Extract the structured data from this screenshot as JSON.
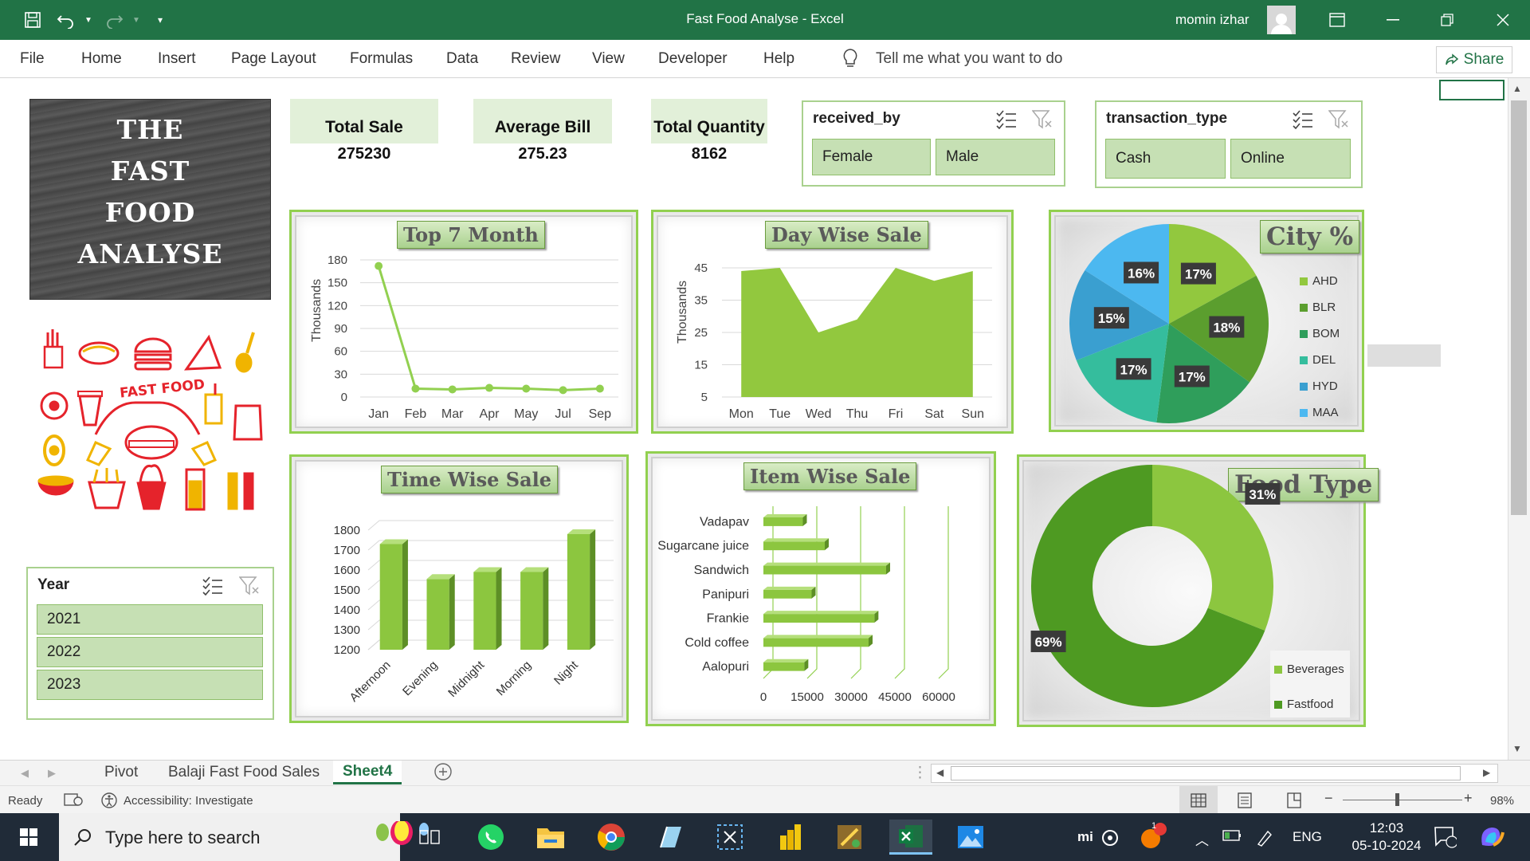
{
  "window": {
    "title": "Fast Food Analyse  -  Excel",
    "user": "momin izhar"
  },
  "ribbon": {
    "tabs": [
      "File",
      "Home",
      "Insert",
      "Page Layout",
      "Formulas",
      "Data",
      "Review",
      "View",
      "Developer",
      "Help"
    ],
    "tell_me": "Tell me what you want to do",
    "share": "Share"
  },
  "dashboard": {
    "logo_lines": [
      "THE",
      "FAST",
      "FOOD",
      "ANALYSE"
    ],
    "kpis": [
      {
        "label": "Total Sale",
        "value": "275230"
      },
      {
        "label": "Average Bill",
        "value": "275.23"
      },
      {
        "label": "Total Quantity",
        "value": "8162"
      }
    ],
    "slicers": {
      "received_by": {
        "header": "received_by",
        "items": [
          "Female",
          "Male"
        ]
      },
      "transaction_type": {
        "header": "transaction_type",
        "items": [
          "Cash",
          "Online"
        ]
      },
      "year": {
        "header": "Year",
        "items": [
          "2021",
          "2022",
          "2023"
        ]
      }
    },
    "clipart_label": "FAST FOOD"
  },
  "chart_data": [
    {
      "type": "line",
      "title": "Top 7 Month",
      "ylabel": "Thousands",
      "categories": [
        "Jan",
        "Feb",
        "Mar",
        "Apr",
        "May",
        "Jul",
        "Sep"
      ],
      "values": [
        172,
        11,
        10,
        12,
        11,
        9,
        11
      ],
      "ylim": [
        0,
        180
      ],
      "yticks": [
        0,
        30,
        60,
        90,
        120,
        150,
        180
      ],
      "grid": true,
      "color": "#92d050"
    },
    {
      "type": "area",
      "title": "Day Wise Sale",
      "ylabel": "Thousands",
      "categories": [
        "Mon",
        "Tue",
        "Wed",
        "Thu",
        "Fri",
        "Sat",
        "Sun"
      ],
      "values": [
        44,
        45,
        25,
        29,
        45,
        41,
        44
      ],
      "ylim": [
        5,
        45
      ],
      "yticks": [
        5,
        15,
        25,
        35,
        45
      ],
      "grid": true,
      "color": "#92c83e"
    },
    {
      "type": "pie",
      "title": "City %",
      "categories": [
        "AHD",
        "BLR",
        "BOM",
        "DEL",
        "HYD",
        "MAA"
      ],
      "values": [
        17,
        18,
        17,
        17,
        15,
        16
      ],
      "labels": [
        "17%",
        "18%",
        "17%",
        "17%",
        "15%",
        "16%"
      ],
      "colors": [
        "#92c83e",
        "#5b9e2e",
        "#2f9e5b",
        "#35bd9d",
        "#3a9fd0",
        "#4cb8f0"
      ],
      "legend": "right"
    },
    {
      "type": "bar",
      "title": "Time Wise Sale",
      "categories": [
        "Afternoon",
        "Evening",
        "Midnight",
        "Morning",
        "Night"
      ],
      "values": [
        1730,
        1555,
        1590,
        1590,
        1780
      ],
      "ylim": [
        1200,
        1800
      ],
      "yticks": [
        1200,
        1300,
        1400,
        1500,
        1600,
        1700,
        1800
      ],
      "color": "#92c83e"
    },
    {
      "type": "bar",
      "orientation": "horizontal",
      "title": "Item Wise Sale",
      "categories": [
        "Vadapav",
        "Sugarcane juice",
        "Sandwich",
        "Panipuri",
        "Frankie",
        "Cold coffee",
        "Aalopuri"
      ],
      "values": [
        13500,
        21000,
        42000,
        16500,
        38000,
        36000,
        14000
      ],
      "xlim": [
        0,
        60000
      ],
      "xticks": [
        0,
        15000,
        30000,
        45000,
        60000
      ],
      "color": "#92c83e"
    },
    {
      "type": "pie",
      "subtype": "donut",
      "title": "Food Type",
      "categories": [
        "Beverages",
        "Fastfood"
      ],
      "values": [
        31,
        69
      ],
      "labels": [
        "31%",
        "69%"
      ],
      "colors": [
        "#8cc63f",
        "#4e9a22"
      ],
      "legend": "bottom-right"
    }
  ],
  "sheet_tabs": [
    "Pivot",
    "Balaji Fast Food Sales",
    "Sheet4"
  ],
  "active_sheet": "Sheet4",
  "status": {
    "ready": "Ready",
    "accessibility": "Accessibility: Investigate",
    "zoom": "98%"
  },
  "taskbar": {
    "search_placeholder": "Type here to search",
    "language": "ENG",
    "time": "12:03",
    "date": "05-10-2024",
    "notification_count": "1"
  },
  "colors": {
    "excel_green": "#217346",
    "accent_green": "#92d050",
    "slicer_fill": "#c6e0b4",
    "kpi_fill": "#e2f0d9"
  }
}
